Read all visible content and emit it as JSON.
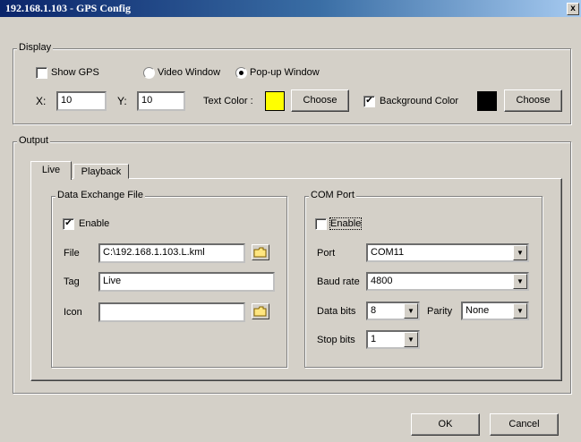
{
  "window": {
    "title": "192.168.1.103 - GPS Config",
    "close_glyph": "x"
  },
  "display": {
    "legend": "Display",
    "show_gps_label": "Show GPS",
    "video_window_label": "Video Window",
    "popup_window_label": "Pop-up Window",
    "x_label": "X:",
    "x_value": "10",
    "y_label": "Y:",
    "y_value": "10",
    "text_color_label": "Text Color :",
    "text_color": "#ffff00",
    "choose_label": "Choose",
    "background_color_label": "Background Color",
    "background_color": "#000000",
    "choose2_label": "Choose"
  },
  "output": {
    "legend": "Output",
    "tabs": [
      {
        "label": "Live"
      },
      {
        "label": "Playback"
      }
    ],
    "data_exchange": {
      "legend": "Data Exchange File",
      "enable_label": "Enable",
      "file_label": "File",
      "file_value": "C:\\192.168.1.103.L.kml",
      "tag_label": "Tag",
      "tag_value": "Live",
      "icon_label": "Icon",
      "icon_value": ""
    },
    "com_port": {
      "legend": "COM Port",
      "enable_label": "Enable",
      "port_label": "Port",
      "port_value": "COM11",
      "baud_label": "Baud rate",
      "baud_value": "4800",
      "data_bits_label": "Data bits",
      "data_bits_value": "8",
      "parity_label": "Parity",
      "parity_value": "None",
      "stop_bits_label": "Stop bits",
      "stop_bits_value": "1"
    }
  },
  "footer": {
    "ok_label": "OK",
    "cancel_label": "Cancel"
  }
}
